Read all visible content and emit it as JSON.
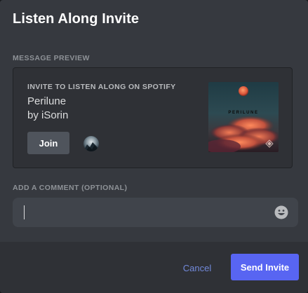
{
  "modal": {
    "title": "Listen Along Invite"
  },
  "preview": {
    "section_label": "MESSAGE PREVIEW",
    "eyebrow": "INVITE TO LISTEN ALONG ON SPOTIFY",
    "track": "Perilune",
    "artist_line": "by iSorin",
    "join_label": "Join",
    "album_title": "PERILUNE"
  },
  "comment": {
    "section_label": "ADD A COMMENT (OPTIONAL)",
    "value": "",
    "emoji_icon": "smiley-face-icon"
  },
  "footer": {
    "cancel_label": "Cancel",
    "send_label": "Send Invite"
  },
  "colors": {
    "modal_bg": "#36393f",
    "card_bg": "#2f3136",
    "accent": "#5865f2",
    "link": "#7289da",
    "input_bg": "#40444b"
  }
}
